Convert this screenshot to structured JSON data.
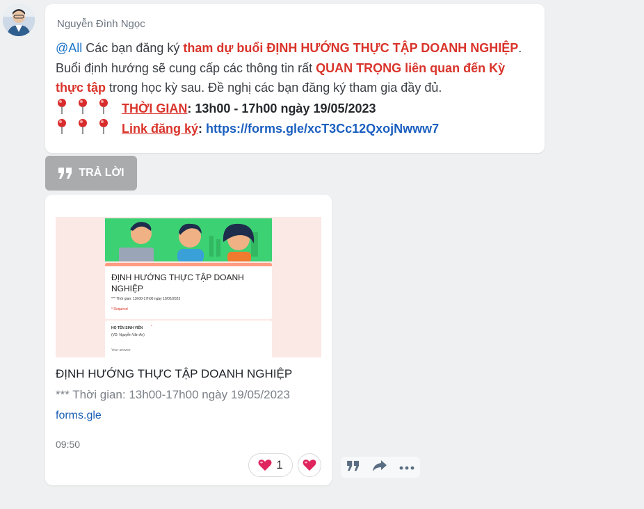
{
  "message": {
    "sender": "Nguyễn Đình Ngọc",
    "mention": "@All",
    "seg1": "  Các bạn đăng ký ",
    "seg2": "tham dự buổi ĐỊNH HƯỚNG THỰC TẬP DOANH NGHIỆP",
    "seg3": ".",
    "seg4": "Buổi định hướng sẽ cung cấp các thông tin rất ",
    "seg5": "QUAN TRỌNG liên quan đến Kỳ thực tập",
    "seg6": " trong học kỳ sau. Đề nghị các bạn đăng ký tham gia đầy đủ.",
    "time_label": "THỜI GIAN",
    "time_value": ": 13h00 - 17h00 ngày 19/05/2023",
    "link_label": "Link đăng ký",
    "colon": ": ",
    "link_url": "https://forms.gle/xcT3Cc12QxojNwww7"
  },
  "reply_button": {
    "label": "TRẢ LỜI"
  },
  "link_card": {
    "preview": {
      "form_title": "ĐỊNH HƯỚNG THỰC TẬP DOANH NGHIỆP",
      "form_subtitle": "*** Thời gian: 13h00-17h00 ngày 19/05/2023",
      "required": "* Required",
      "field_label": "HỌ TÊN SINH VIÊN",
      "field_asterisk": "*",
      "field_hint": "(VD: Nguyễn Văn An)",
      "answer_placeholder": "Your answer"
    },
    "title": "ĐỊNH HƯỚNG THỰC TẬP DOANH NGHIỆP",
    "description": "*** Thời gian: 13h00-17h00 ngày 19/05/2023",
    "domain": "forms.gle",
    "time": "09:50",
    "reaction_count": "1"
  },
  "colors": {
    "accent_red": "#d9342b",
    "link_blue": "#1b5fbf",
    "reaction_red": "#e0245e"
  },
  "icons": [
    "pushpin-icon",
    "quote-icon",
    "heart-icon",
    "share-arrow-icon",
    "more-icon"
  ]
}
